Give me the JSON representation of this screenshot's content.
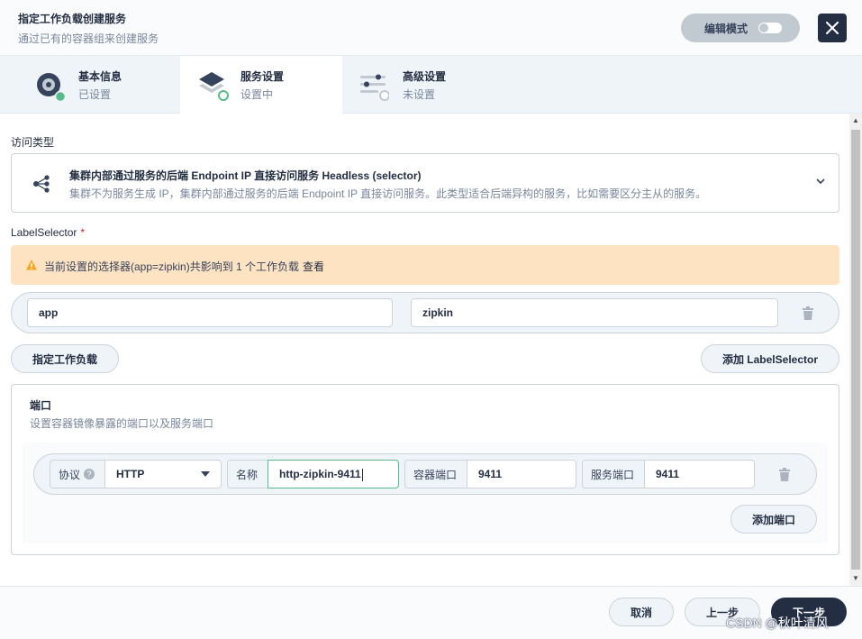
{
  "header": {
    "title": "指定工作负载创建服务",
    "subtitle": "通过已有的容器组来创建服务",
    "edit_mode_label": "编辑模式"
  },
  "steps": [
    {
      "title": "基本信息",
      "status": "已设置"
    },
    {
      "title": "服务设置",
      "status": "设置中"
    },
    {
      "title": "高级设置",
      "status": "未设置"
    }
  ],
  "access": {
    "label": "访问类型",
    "title": "集群内部通过服务的后端 Endpoint IP 直接访问服务 Headless (selector)",
    "description": "集群不为服务生成 IP，集群内部通过服务的后端 Endpoint IP 直接访问服务。此类型适合后端异构的服务，比如需要区分主从的服务。"
  },
  "label_selector": {
    "label": "LabelSelector",
    "required_mark": "*",
    "warning_text": "当前设置的选择器(app=zipkin)共影响到 1 个工作负载",
    "warning_link": "查看",
    "key": "app",
    "value": "zipkin",
    "specify_workload_button": "指定工作负载",
    "add_button": "添加 LabelSelector"
  },
  "ports": {
    "title": "端口",
    "description": "设置容器镜像暴露的端口以及服务端口",
    "protocol_label": "协议",
    "protocol_help": "?",
    "protocol_value": "HTTP",
    "name_label": "名称",
    "name_value": "http-zipkin-9411",
    "container_port_label": "容器端口",
    "container_port_value": "9411",
    "service_port_label": "服务端口",
    "service_port_value": "9411",
    "add_port_button": "添加端口"
  },
  "footer": {
    "cancel": "取消",
    "previous": "上一步",
    "next": "下一步"
  },
  "watermark": "CSDN @秋叶清风",
  "colors": {
    "accent_green": "#55bc8a",
    "dark": "#242e42",
    "warning_bg": "#fee3c2",
    "warning_icon": "#f5a623"
  }
}
